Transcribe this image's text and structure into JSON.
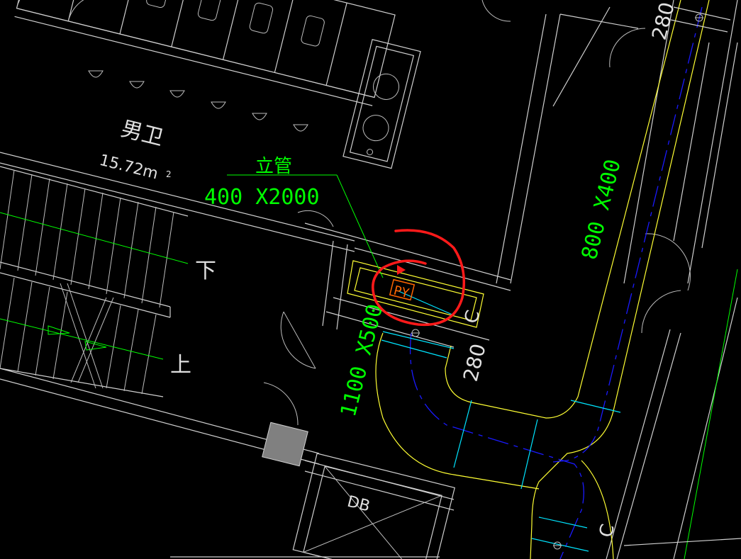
{
  "room": {
    "name": "男卫",
    "area": "15.72m",
    "area_unit_superscript": "2"
  },
  "annotations": {
    "riser_label": "立管",
    "riser_size": "400 X2000",
    "duct_main": "800 X400",
    "duct_branch": "1100 X500",
    "dim_a": "280",
    "dim_b": "280",
    "dim_c": "C",
    "dim_d": "C",
    "tag": "PY",
    "stair_down": "下",
    "stair_up": "上",
    "elevator_text": "DB"
  },
  "colors": {
    "background": "#000000",
    "wall": "#d0d0d0",
    "duct_outline": "#ffff33",
    "duct_centerline": "#1a1aff",
    "duct_joint": "#00e5ff",
    "leader": "#00ff00",
    "tag": "#ff6600",
    "markup_circle": "#ff1a1a",
    "column_fill": "#808080"
  }
}
